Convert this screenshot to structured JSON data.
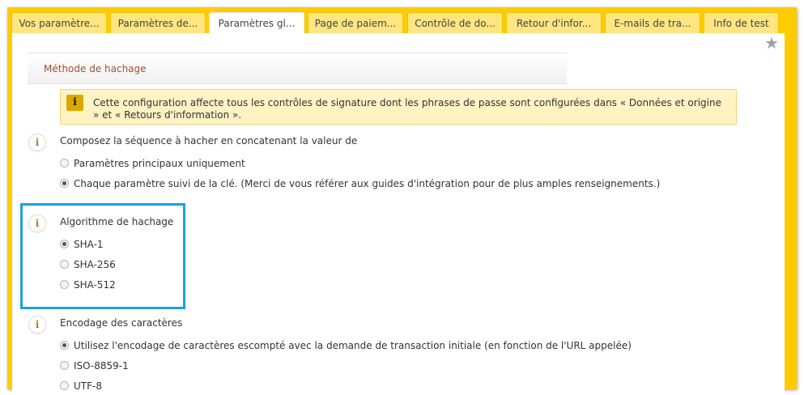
{
  "tabs": [
    {
      "label": "Vos paramètre..."
    },
    {
      "label": "Paramètres de..."
    },
    {
      "label": "Paramètres gl..."
    },
    {
      "label": "Page de paiem..."
    },
    {
      "label": "Contrôle de do..."
    },
    {
      "label": "Retour d'infor..."
    },
    {
      "label": "E-mails de tra..."
    },
    {
      "label": "Info de test"
    }
  ],
  "active_tab_index": 2,
  "favorite_icon": "star-icon",
  "section": {
    "title": "Méthode de hachage"
  },
  "notice": {
    "icon": "info-icon",
    "text": "Cette configuration affecte tous les contrôles de signature dont les phrases de passe sont configurées dans « Données et origine » et « Retours d'information »."
  },
  "groups": [
    {
      "label": "Composez la séquence à hacher en concatenant la valeur de",
      "options": [
        {
          "label": "Paramètres principaux uniquement",
          "selected": false
        },
        {
          "label": "Chaque paramètre suivi de la clé. (Merci de vous référer aux guides d'intégration pour de plus amples renseignements.)",
          "selected": true
        }
      ]
    },
    {
      "label": "Algorithme de hachage",
      "options": [
        {
          "label": "SHA-1",
          "selected": true
        },
        {
          "label": "SHA-256",
          "selected": false
        },
        {
          "label": "SHA-512",
          "selected": false
        }
      ]
    },
    {
      "label": "Encodage des caractères",
      "options": [
        {
          "label": "Utilisez l'encodage de caractères escompté avec la demande de transaction initiale (en fonction de l'URL appelée)",
          "selected": true
        },
        {
          "label": "ISO-8859-1",
          "selected": false
        },
        {
          "label": "UTF-8",
          "selected": false
        }
      ]
    }
  ],
  "colors": {
    "frame": "#ffcc00",
    "highlight_border": "#1ea0e0",
    "section_title": "#a0522d",
    "notice_bg": "#fff3c4"
  }
}
